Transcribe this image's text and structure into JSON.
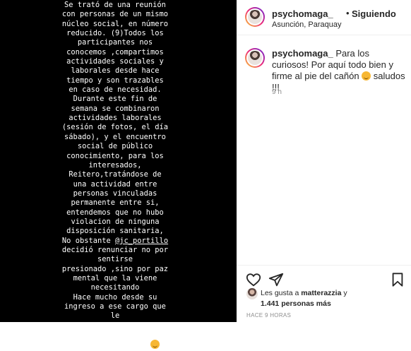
{
  "story": {
    "text": "Se trató de una reunión\ncon personas de un mismo\nnúcleo social, en número\nreducido. (9)Todos los\nparticipantes nos\nconocemos ,compartimos\nactividades sociales y\nlaborales desde hace\ntiempo y son trazables\nen caso de necesidad.\nDurante este fin de\nsemana se combinaron\nactividades laborales\n(sesión de fotos, el día\nsábado), y el encuentro\nsocial de público\nconocimiento, para los\ninteresados,\nReitero,tratándose de\nuna actividad entre\npersonas vinculadas\npermanente entre si,\nentendemos que no hubo\nviolacion de ninguna\ndisposición sanitaria,",
    "text_before_mention": "No obstante ",
    "mention": "@jc_portillo",
    "text_after": "\ndecidió renunciar no por\nsentirse\npresionado ,sino por paz\nmental que la viene\nnecesitando\nHace mucho desde su\ningreso a ese cargo que\nle\nDejaba poco y nada de\ntiempo para su vida\npersonal, saludos "
  },
  "header": {
    "username": "psychomaga_",
    "separator": "•",
    "following_label": "Siguiendo",
    "location": "Asunción, Paraquay"
  },
  "caption": {
    "username": "psychomaga_",
    "text": " Para los curiosos! Por aquí todo bien y firme al pie del cañón ",
    "text_end": " saludos !!!",
    "time": "9 h"
  },
  "likes": {
    "prefix": "Les gusta a ",
    "user": "matterazzia",
    "suffix": " y",
    "count": "1.441 personas más"
  },
  "post_time": "HACE 9 HORAS",
  "icons": [
    "heart-icon",
    "share-icon",
    "bookmark-icon",
    "emoji-icon"
  ]
}
